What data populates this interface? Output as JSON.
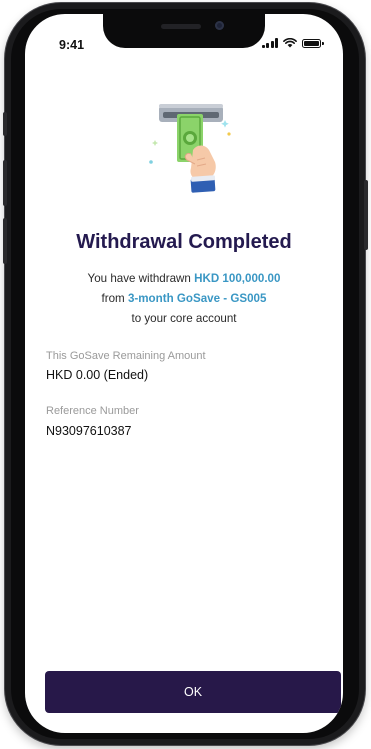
{
  "status_bar": {
    "time": "9:41",
    "icons": [
      "signal-icon",
      "wifi-icon",
      "battery-icon"
    ]
  },
  "illustration": {
    "icon": "atm-cash-withdrawal-icon"
  },
  "title": "Withdrawal Completed",
  "message": {
    "line1_prefix": "You have withdrawn ",
    "amount": "HKD 100,000.00",
    "line2_prefix": "from ",
    "plan_name": "3-month GoSave - GS005",
    "line3": "to your core account"
  },
  "details": {
    "remaining_label": "This GoSave Remaining Amount",
    "remaining_value": "HKD 0.00 (Ended)",
    "reference_label": "Reference Number",
    "reference_value": "N93097610387"
  },
  "ok_button": {
    "label": "OK"
  },
  "colors": {
    "title": "#241a4f",
    "highlight": "#3a97c4",
    "button_bg": "#271849",
    "muted": "#9a9a9a"
  }
}
